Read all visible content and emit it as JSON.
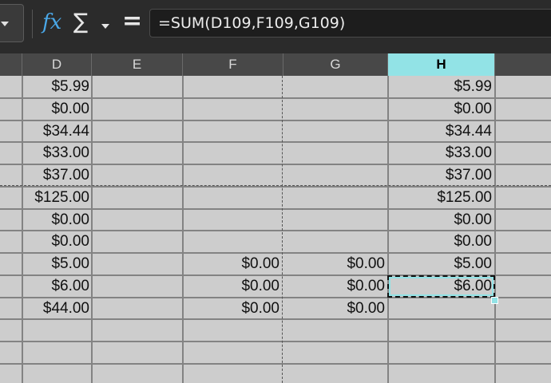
{
  "formula_bar": {
    "fx_label": "𝑓x",
    "sigma_label": "∑",
    "equals_label": "=",
    "formula": "=SUM(D109,F109,G109)"
  },
  "columns": {
    "d": "D",
    "e": "E",
    "f": "F",
    "g": "G",
    "h": "H"
  },
  "selected_column": "H",
  "rows": [
    {
      "d": "$5.99",
      "f": "",
      "g": "",
      "h": "$5.99"
    },
    {
      "d": "$0.00",
      "f": "",
      "g": "",
      "h": "$0.00"
    },
    {
      "d": "$34.44",
      "f": "",
      "g": "",
      "h": "$34.44"
    },
    {
      "d": "$33.00",
      "f": "",
      "g": "",
      "h": "$33.00"
    },
    {
      "d": "$37.00",
      "f": "",
      "g": "",
      "h": "$37.00"
    },
    {
      "d": "$125.00",
      "f": "",
      "g": "",
      "h": "$125.00"
    },
    {
      "d": "$0.00",
      "f": "",
      "g": "",
      "h": "$0.00"
    },
    {
      "d": "$0.00",
      "f": "",
      "g": "",
      "h": "$0.00"
    },
    {
      "d": "$5.00",
      "f": "$0.00",
      "g": "$0.00",
      "h": "$5.00"
    },
    {
      "d": "$6.00",
      "f": "$0.00",
      "g": "$0.00",
      "h": "$6.00"
    },
    {
      "d": "$44.00",
      "f": "$0.00",
      "g": "$0.00",
      "h": ""
    },
    {
      "d": "",
      "f": "",
      "g": "",
      "h": ""
    },
    {
      "d": "",
      "f": "",
      "g": "",
      "h": ""
    }
  ],
  "accent_color": "#92e3e6"
}
